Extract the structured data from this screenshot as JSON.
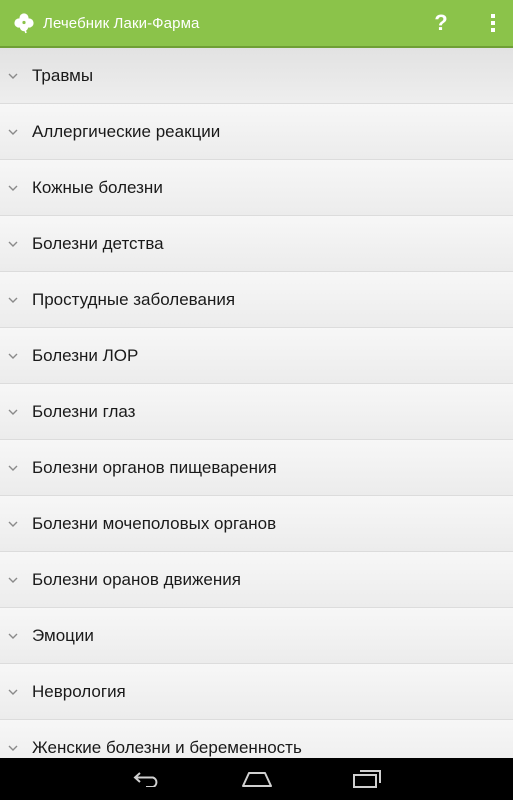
{
  "action_bar": {
    "title": "Лечебник Лаки-Фарма",
    "app_icon": "clover-icon",
    "help_label": "?",
    "overflow_icon": "overflow-menu-icon",
    "background_color": "#8bc34a"
  },
  "list": {
    "expand_icon": "chevron-down-icon",
    "items": [
      {
        "label": "Травмы"
      },
      {
        "label": "Аллергические реакции"
      },
      {
        "label": "Кожные болезни"
      },
      {
        "label": "Болезни детства"
      },
      {
        "label": "Простудные заболевания"
      },
      {
        "label": "Болезни ЛОР"
      },
      {
        "label": "Болезни глаз"
      },
      {
        "label": "Болезни органов пищеварения"
      },
      {
        "label": "Болезни мочеполовых органов"
      },
      {
        "label": "Болезни оранов движения"
      },
      {
        "label": "Эмоции"
      },
      {
        "label": "Неврология"
      },
      {
        "label": "Женские болезни и беременность"
      }
    ]
  },
  "nav_bar": {
    "back_icon": "back-icon",
    "home_icon": "home-icon",
    "recents_icon": "recent-apps-icon"
  }
}
